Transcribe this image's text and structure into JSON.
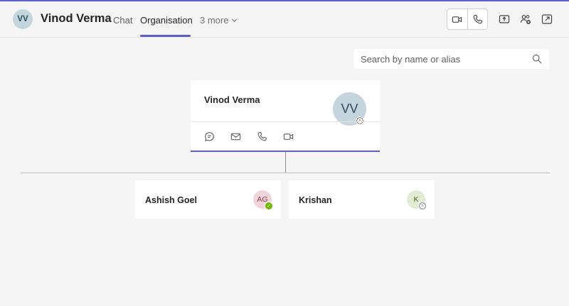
{
  "header": {
    "avatar_initials": "VV",
    "name": "Vinod Verma",
    "tabs": [
      {
        "label": "Chat"
      },
      {
        "label": "Organisation"
      }
    ],
    "more_label": "3 more"
  },
  "search": {
    "placeholder": "Search by name or alias",
    "icon": "search-icon"
  },
  "org": {
    "main": {
      "name": "Vinod Verma",
      "initials": "VV",
      "status": "offline",
      "actions": [
        "chat-icon",
        "mail-icon",
        "phone-icon",
        "video-icon"
      ]
    },
    "reports": [
      {
        "name": "Ashish Goel",
        "initials": "AG",
        "status": "available"
      },
      {
        "name": "Krishan",
        "initials": "K",
        "status": "offline"
      }
    ]
  },
  "colors": {
    "accent": "#5b5fc7",
    "avatar_main": "#c5d5de",
    "avatar_ag": "#f1d4da",
    "avatar_k": "#e2ecd3",
    "status_available": "#6bb700"
  }
}
